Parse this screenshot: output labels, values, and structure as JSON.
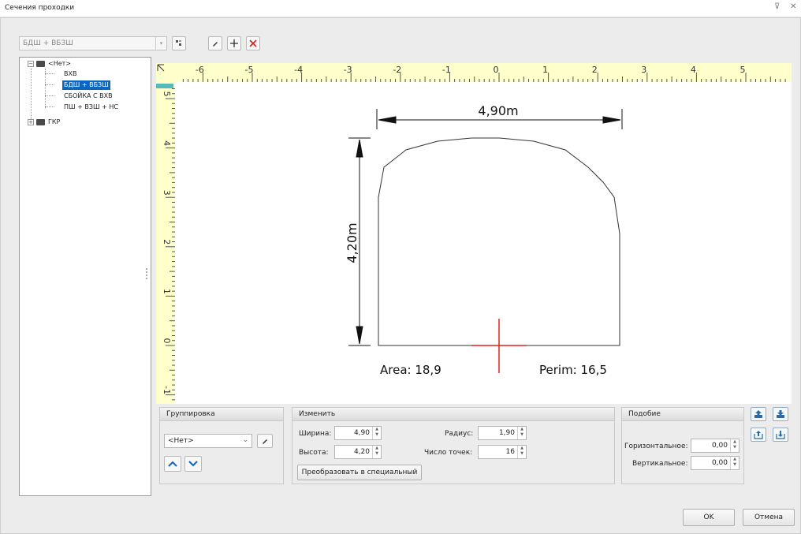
{
  "window": {
    "title": "Сечения проходки",
    "pin_glyph": "⊽",
    "close_glyph": "✕"
  },
  "toolbar": {
    "section_combo": "БДШ + ВБЗШ"
  },
  "tree": {
    "root_label": "<Нет>",
    "children": [
      "ВХВ",
      "БДШ + ВБЗШ",
      "СБОЙКА С ВХВ",
      "ПШ + ВЗШ + НС"
    ],
    "selected_index": 1,
    "second_root": "ГКР"
  },
  "ruler": {
    "x_ticks": [
      "-6",
      "-5",
      "-4",
      "-3",
      "-2",
      "-1",
      "0",
      "1",
      "2",
      "3",
      "4",
      "5"
    ],
    "y_ticks": [
      "5",
      "4",
      "3",
      "2",
      "1",
      "0",
      "-1"
    ]
  },
  "drawing": {
    "width_label": "4,90m",
    "height_label": "4,20m",
    "area_label": "Area: 18,9",
    "perim_label": "Perim: 16,5"
  },
  "grouping": {
    "title": "Группировка",
    "combo_value": "<Нет>"
  },
  "modify": {
    "title": "Изменить",
    "width_label": "Ширина:",
    "width_value": "4,90",
    "height_label": "Высота:",
    "height_value": "4,20",
    "radius_label": "Радиус:",
    "radius_value": "1,90",
    "points_label": "Число точек:",
    "points_value": "16",
    "convert_button": "Преобразовать в специальный"
  },
  "similarity": {
    "title": "Подобие",
    "horizontal_label": "Горизонтальное:",
    "horizontal_value": "0,00",
    "vertical_label": "Вертикальное:",
    "vertical_value": "0,00"
  },
  "footer": {
    "ok": "OK",
    "cancel": "Отмена"
  },
  "colors": {
    "accent": "#0a66c2",
    "ruler": "#ffffcc",
    "origin_cross": "#e02020",
    "delete": "#d62020"
  }
}
